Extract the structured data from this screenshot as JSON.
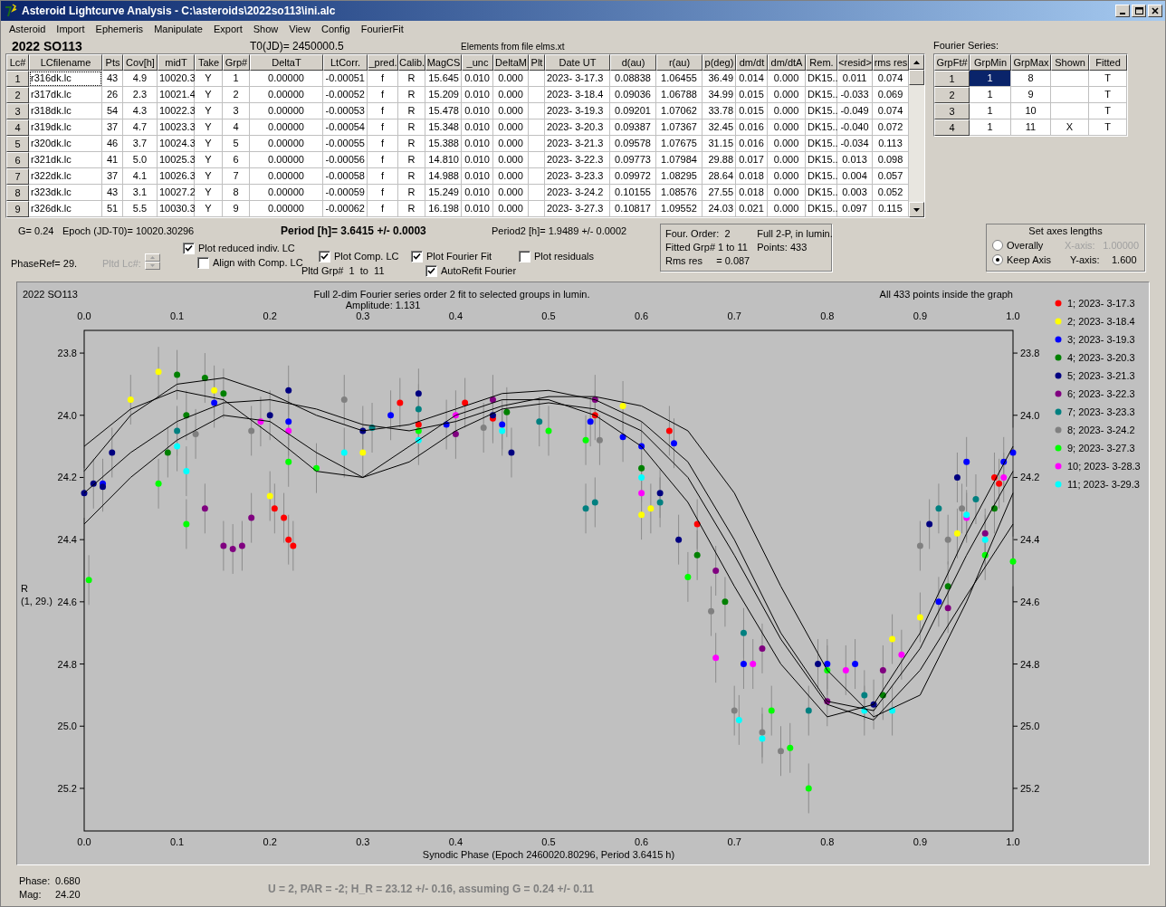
{
  "window": {
    "title": "Asteroid Lightcurve Analysis - C:\\asteroids\\2022so113\\ini.alc"
  },
  "menu": [
    "Asteroid",
    "Import",
    "Ephemeris",
    "Manipulate",
    "Export",
    "Show",
    "View",
    "Config",
    "FourierFit"
  ],
  "object_name": "2022 SO113",
  "t0": "T0(JD)= 2450000.5",
  "elements_note": "Elements from file elms.xt",
  "lc_table": {
    "columns": [
      "Lc#",
      "LCfilename",
      "Pts",
      "Cov[h]",
      "midT",
      "Take",
      "Grp#",
      "DeltaT",
      "LtCorr.",
      "_pred.",
      "Calib.",
      "MagCS",
      "_unc",
      "DeltaM",
      "Plt",
      "Date UT",
      "d(au)",
      "r(au)",
      "p(deg)",
      "dm/dt",
      "dm/dtA",
      "Rem.",
      "<resid>",
      "rms res"
    ],
    "rows": [
      {
        "focused": true,
        "cells": [
          "1",
          "r316dk.lc",
          "43",
          "4.9",
          "10020.3",
          "Y",
          "1",
          "0.00000",
          "-0.00051",
          "f",
          "R",
          "15.645",
          "0.010",
          "0.000",
          "",
          "2023- 3-17.3",
          "0.08838",
          "1.06455",
          "36.49",
          "0.014",
          "0.000",
          "DK15..",
          "0.011",
          "0.074"
        ]
      },
      {
        "focused": false,
        "cells": [
          "2",
          "r317dk.lc",
          "26",
          "2.3",
          "10021.4",
          "Y",
          "2",
          "0.00000",
          "-0.00052",
          "f",
          "R",
          "15.209",
          "0.010",
          "0.000",
          "",
          "2023- 3-18.4",
          "0.09036",
          "1.06788",
          "34.99",
          "0.015",
          "0.000",
          "DK15..",
          "-0.033",
          "0.069"
        ]
      },
      {
        "focused": false,
        "cells": [
          "3",
          "r318dk.lc",
          "54",
          "4.3",
          "10022.3",
          "Y",
          "3",
          "0.00000",
          "-0.00053",
          "f",
          "R",
          "15.478",
          "0.010",
          "0.000",
          "",
          "2023- 3-19.3",
          "0.09201",
          "1.07062",
          "33.78",
          "0.015",
          "0.000",
          "DK15..",
          "-0.049",
          "0.074"
        ]
      },
      {
        "focused": false,
        "cells": [
          "4",
          "r319dk.lc",
          "37",
          "4.7",
          "10023.3",
          "Y",
          "4",
          "0.00000",
          "-0.00054",
          "f",
          "R",
          "15.348",
          "0.010",
          "0.000",
          "",
          "2023- 3-20.3",
          "0.09387",
          "1.07367",
          "32.45",
          "0.016",
          "0.000",
          "DK15..",
          "-0.040",
          "0.072"
        ]
      },
      {
        "focused": false,
        "cells": [
          "5",
          "r320dk.lc",
          "46",
          "3.7",
          "10024.3",
          "Y",
          "5",
          "0.00000",
          "-0.00055",
          "f",
          "R",
          "15.388",
          "0.010",
          "0.000",
          "",
          "2023- 3-21.3",
          "0.09578",
          "1.07675",
          "31.15",
          "0.016",
          "0.000",
          "DK15..",
          "-0.034",
          "0.113"
        ]
      },
      {
        "focused": false,
        "cells": [
          "6",
          "r321dk.lc",
          "41",
          "5.0",
          "10025.3",
          "Y",
          "6",
          "0.00000",
          "-0.00056",
          "f",
          "R",
          "14.810",
          "0.010",
          "0.000",
          "",
          "2023- 3-22.3",
          "0.09773",
          "1.07984",
          "29.88",
          "0.017",
          "0.000",
          "DK15..",
          "0.013",
          "0.098"
        ]
      },
      {
        "focused": false,
        "cells": [
          "7",
          "r322dk.lc",
          "37",
          "4.1",
          "10026.3",
          "Y",
          "7",
          "0.00000",
          "-0.00058",
          "f",
          "R",
          "14.988",
          "0.010",
          "0.000",
          "",
          "2023- 3-23.3",
          "0.09972",
          "1.08295",
          "28.64",
          "0.018",
          "0.000",
          "DK15..",
          "0.004",
          "0.057"
        ]
      },
      {
        "focused": false,
        "cells": [
          "8",
          "r323dk.lc",
          "43",
          "3.1",
          "10027.2",
          "Y",
          "8",
          "0.00000",
          "-0.00059",
          "f",
          "R",
          "15.249",
          "0.010",
          "0.000",
          "",
          "2023- 3-24.2",
          "0.10155",
          "1.08576",
          "27.55",
          "0.018",
          "0.000",
          "DK15..",
          "0.003",
          "0.052"
        ]
      },
      {
        "focused": false,
        "cells": [
          "9",
          "r326dk.lc",
          "51",
          "5.5",
          "10030.3",
          "Y",
          "9",
          "0.00000",
          "-0.00062",
          "f",
          "R",
          "16.198",
          "0.010",
          "0.000",
          "",
          "2023- 3-27.3",
          "0.10817",
          "1.09552",
          "24.03",
          "0.021",
          "0.000",
          "DK15..",
          "0.097",
          "0.115"
        ]
      }
    ]
  },
  "fourier": {
    "label": "Fourier Series:",
    "columns": [
      "GrpFt#",
      "GrpMin",
      "GrpMax",
      "Shown",
      "Fitted"
    ],
    "rows": [
      {
        "selected": true,
        "cells": [
          "1",
          "1",
          "8",
          "",
          "T"
        ]
      },
      {
        "selected": false,
        "cells": [
          "2",
          "1",
          "9",
          "",
          "T"
        ]
      },
      {
        "selected": false,
        "cells": [
          "3",
          "1",
          "10",
          "",
          "T"
        ]
      },
      {
        "selected": false,
        "cells": [
          "4",
          "1",
          "11",
          "X",
          "T"
        ]
      }
    ]
  },
  "info": {
    "g": "G= 0.24",
    "epoch": "Epoch (JD-T0)= 10020.30296",
    "period": "Period [h]= 3.6415 +/- 0.0003",
    "period2": "Period2 [h]= 1.9489 +/- 0.0002",
    "phase_ref": "PhaseRef= 29.",
    "pltd_lc": {
      "label": "Pltd Lc#:",
      "disabled": true
    },
    "pltd_grp": "Pltd Grp#  1  to  11"
  },
  "checkboxes": [
    {
      "label": "Plot reduced indiv. LC",
      "checked": true
    },
    {
      "label": "Align with Comp. LC",
      "checked": false
    },
    {
      "label": "Plot Comp. LC",
      "checked": true
    },
    {
      "label": "Plot Fourier Fit",
      "checked": true
    },
    {
      "label": "AutoRefit Fourier",
      "checked": true
    },
    {
      "label": "Plot residuals",
      "checked": false
    }
  ],
  "fit_info": {
    "left": [
      "Four. Order:  2",
      "Fitted Grp# 1 to 11",
      "Rms res     = 0.087"
    ],
    "right": [
      "Full 2-P, in lumin.",
      "Points: 433"
    ]
  },
  "axes": {
    "title": "Set axes lengths",
    "options": [
      {
        "label": "Overally",
        "selected": false
      },
      {
        "label": "Keep Axis",
        "selected": true
      }
    ],
    "x_axis": {
      "label": "X-axis:",
      "value": "1.00000",
      "disabled": true
    },
    "y_axis": {
      "label": "Y-axis:",
      "value": "1.600",
      "disabled": false
    }
  },
  "plot": {
    "left_title": "2022 SO113",
    "title": "Full 2-dim Fourier series order 2 fit to selected groups in lumin.",
    "amplitude": "Amplitude: 1.131",
    "right_title": "All 433 points inside the graph",
    "ylabel": [
      "R",
      "(1, 29.)"
    ],
    "chart_data": {
      "type": "scatter",
      "xlabel": "Synodic Phase (Epoch 2460020.80296, Period 3.6415 h)",
      "xlim": [
        0,
        1
      ],
      "ylim": [
        25.337,
        23.727
      ],
      "xticks": [
        {
          "value": 0,
          "label": "0.0"
        },
        {
          "value": 0.1,
          "label": "0.1"
        },
        {
          "value": 0.2,
          "label": "0.2"
        },
        {
          "value": 0.3,
          "label": "0.3"
        },
        {
          "value": 0.4,
          "label": "0.4"
        },
        {
          "value": 0.5,
          "label": "0.5"
        },
        {
          "value": 0.6,
          "label": "0.6"
        },
        {
          "value": 0.7,
          "label": "0.7"
        },
        {
          "value": 0.8,
          "label": "0.8"
        },
        {
          "value": 0.9,
          "label": "0.9"
        },
        {
          "value": 1,
          "label": "1.0"
        }
      ],
      "yticks": [
        {
          "value": 23.8,
          "label": "23.8"
        },
        {
          "value": 24,
          "label": "24.0"
        },
        {
          "value": 24.2,
          "label": "24.2"
        },
        {
          "value": 24.4,
          "label": "24.4"
        },
        {
          "value": 24.6,
          "label": "24.6"
        },
        {
          "value": 24.8,
          "label": "24.8"
        },
        {
          "value": 25,
          "label": "25.0"
        },
        {
          "value": 25.2,
          "label": "25.2"
        }
      ],
      "series": [
        {
          "type": "scatter",
          "name": "1; 2023- 3-17.3",
          "errors": [
            0.08,
            0.08,
            0.08,
            0.08,
            0.08,
            0.08,
            0.08,
            0.08,
            0.08,
            0.08,
            0.08,
            0.08,
            0.08
          ],
          "color": "#ff0000",
          "x": [
            0.205,
            0.215,
            0.225,
            0.22,
            0.34,
            0.36,
            0.41,
            0.44,
            0.55,
            0.63,
            0.66,
            0.98,
            0.985
          ],
          "values": [
            24.3,
            24.33,
            24.42,
            24.4,
            23.96,
            24.03,
            23.96,
            24.01,
            24.0,
            24.05,
            24.35,
            24.2,
            24.22
          ]
        },
        {
          "type": "scatter",
          "name": "2; 2023- 3-18.4",
          "errors": [
            0.08,
            0.08,
            0.08,
            0.08,
            0.08,
            0.08,
            0.08,
            0.08,
            0.08,
            0.08,
            0.08
          ],
          "color": "#ffff00",
          "x": [
            0.05,
            0.08,
            0.14,
            0.2,
            0.3,
            0.58,
            0.6,
            0.61,
            0.87,
            0.9,
            0.94
          ],
          "values": [
            23.95,
            23.86,
            23.92,
            24.26,
            24.12,
            23.97,
            24.32,
            24.3,
            24.72,
            24.65,
            24.38
          ]
        },
        {
          "type": "scatter",
          "name": "3; 2023- 3-19.3",
          "errors": [
            0.08,
            0.08,
            0.08,
            0.08,
            0.08,
            0.08,
            0.08,
            0.08,
            0.08,
            0.08,
            0.08,
            0.08,
            0.08,
            0.08,
            0.08,
            0.08,
            0.08
          ],
          "color": "#0000ff",
          "x": [
            0.02,
            0.14,
            0.22,
            0.33,
            0.39,
            0.45,
            0.545,
            0.58,
            0.6,
            0.635,
            0.71,
            0.8,
            0.83,
            0.92,
            0.95,
            0.99,
            1.0
          ],
          "values": [
            24.22,
            23.96,
            24.02,
            24.0,
            24.03,
            24.03,
            24.02,
            24.07,
            24.1,
            24.09,
            24.8,
            24.8,
            24.8,
            24.6,
            24.15,
            24.15,
            24.12
          ]
        },
        {
          "type": "scatter",
          "name": "4; 2023- 3-20.3",
          "errors": [
            0.08,
            0.08,
            0.08,
            0.08,
            0.08,
            0.08,
            0.08,
            0.08,
            0.08,
            0.08,
            0.08,
            0.08
          ],
          "color": "#008000",
          "x": [
            0.09,
            0.1,
            0.11,
            0.13,
            0.15,
            0.455,
            0.6,
            0.66,
            0.69,
            0.86,
            0.93,
            0.98
          ],
          "values": [
            24.12,
            23.87,
            24.0,
            23.88,
            23.93,
            23.99,
            24.17,
            24.45,
            24.6,
            24.9,
            24.55,
            24.3
          ]
        },
        {
          "type": "scatter",
          "name": "5; 2023- 3-21.3",
          "errors": [
            0.08,
            0.08,
            0.08,
            0.08,
            0.08,
            0.08,
            0.08,
            0.08,
            0.08,
            0.08,
            0.08,
            0.08,
            0.08,
            0.08,
            0.08,
            0.08
          ],
          "color": "#000080",
          "x": [
            0.0,
            0.01,
            0.02,
            0.03,
            0.2,
            0.22,
            0.3,
            0.36,
            0.44,
            0.46,
            0.62,
            0.64,
            0.79,
            0.85,
            0.91,
            0.94
          ],
          "values": [
            24.25,
            24.22,
            24.23,
            24.12,
            24.0,
            23.92,
            24.05,
            23.93,
            24.0,
            24.12,
            24.25,
            24.4,
            24.8,
            24.93,
            24.35,
            24.2
          ]
        },
        {
          "type": "scatter",
          "name": "6; 2023- 3-22.3",
          "errors": [
            0.08,
            0.08,
            0.08,
            0.08,
            0.08,
            0.08,
            0.08,
            0.08,
            0.08,
            0.08,
            0.08,
            0.08,
            0.08,
            0.08
          ],
          "color": "#800080",
          "x": [
            0.13,
            0.15,
            0.16,
            0.17,
            0.18,
            0.4,
            0.44,
            0.55,
            0.68,
            0.73,
            0.8,
            0.86,
            0.93,
            0.97
          ],
          "values": [
            24.3,
            24.42,
            24.43,
            24.42,
            24.33,
            24.06,
            23.95,
            23.95,
            24.5,
            24.75,
            24.92,
            24.82,
            24.62,
            24.38
          ]
        },
        {
          "type": "scatter",
          "name": "7; 2023- 3-23.3",
          "errors": [
            0.08,
            0.08,
            0.08,
            0.08,
            0.08,
            0.08,
            0.08,
            0.08,
            0.08,
            0.08,
            0.08,
            0.08
          ],
          "color": "#008080",
          "x": [
            0.1,
            0.31,
            0.36,
            0.49,
            0.54,
            0.55,
            0.62,
            0.71,
            0.78,
            0.84,
            0.92,
            0.96
          ],
          "values": [
            24.05,
            24.04,
            23.98,
            24.02,
            24.3,
            24.28,
            24.28,
            24.7,
            24.95,
            24.9,
            24.3,
            24.27
          ]
        },
        {
          "type": "scatter",
          "name": "8; 2023- 3-24.2",
          "errors": [
            0.08,
            0.08,
            0.08,
            0.08,
            0.08,
            0.08,
            0.08,
            0.08,
            0.08,
            0.08,
            0.08,
            0.08
          ],
          "color": "#808080",
          "x": [
            0.12,
            0.18,
            0.28,
            0.43,
            0.555,
            0.675,
            0.7,
            0.73,
            0.75,
            0.9,
            0.93,
            0.945
          ],
          "values": [
            24.06,
            24.05,
            23.95,
            24.04,
            24.08,
            24.63,
            24.95,
            25.02,
            25.08,
            24.42,
            24.4,
            24.3
          ]
        },
        {
          "type": "scatter",
          "name": "9; 2023- 3-27.3",
          "errors": [
            0.08,
            0.08,
            0.08,
            0.08,
            0.08,
            0.08,
            0.08,
            0.08,
            0.08,
            0.08,
            0.08,
            0.08,
            0.08,
            0.08,
            0.08
          ],
          "color": "#00ff00",
          "x": [
            0.005,
            0.08,
            0.11,
            0.22,
            0.25,
            0.36,
            0.5,
            0.54,
            0.65,
            0.74,
            0.76,
            0.78,
            0.8,
            0.97,
            1.0
          ],
          "values": [
            24.53,
            24.22,
            24.35,
            24.15,
            24.17,
            24.05,
            24.05,
            24.08,
            24.52,
            24.95,
            25.07,
            25.2,
            24.82,
            24.45,
            24.47
          ]
        },
        {
          "type": "scatter",
          "name": "10; 2023- 3-28.3",
          "errors": [
            0.08,
            0.08,
            0.08,
            0.08,
            0.08,
            0.08,
            0.08,
            0.08,
            0.08,
            0.08
          ],
          "color": "#ff00ff",
          "x": [
            0.19,
            0.22,
            0.4,
            0.6,
            0.68,
            0.72,
            0.82,
            0.88,
            0.95,
            0.99
          ],
          "values": [
            24.02,
            24.05,
            24.0,
            24.25,
            24.78,
            24.8,
            24.82,
            24.77,
            24.33,
            24.2
          ]
        },
        {
          "type": "scatter",
          "name": "11; 2023- 3-29.3",
          "errors": [
            0.08,
            0.08,
            0.08,
            0.08,
            0.08,
            0.08,
            0.08,
            0.08,
            0.08,
            0.08,
            0.08,
            0.08
          ],
          "color": "#00ffff",
          "x": [
            0.1,
            0.11,
            0.28,
            0.36,
            0.45,
            0.6,
            0.705,
            0.73,
            0.84,
            0.87,
            0.95,
            0.97
          ],
          "values": [
            24.1,
            24.18,
            24.12,
            24.08,
            24.05,
            24.2,
            24.98,
            25.04,
            24.95,
            24.95,
            24.32,
            24.4
          ]
        },
        {
          "type": "line",
          "color": "#000000",
          "x": [
            0,
            0.05,
            0.1,
            0.15,
            0.2,
            0.25,
            0.3,
            0.35,
            0.4,
            0.45,
            0.5,
            0.55,
            0.6,
            0.65,
            0.7,
            0.75,
            0.8,
            0.85,
            0.9,
            0.95,
            1
          ],
          "values": [
            24.25,
            24.12,
            24.02,
            23.96,
            23.95,
            23.98,
            24.03,
            24.05,
            24.02,
            23.97,
            23.94,
            23.94,
            23.97,
            24.05,
            24.25,
            24.55,
            24.82,
            24.97,
            24.9,
            24.6,
            24.25
          ]
        },
        {
          "type": "line",
          "color": "#000000",
          "x": [
            0,
            0.05,
            0.1,
            0.15,
            0.2,
            0.25,
            0.3,
            0.35,
            0.4,
            0.45,
            0.5,
            0.55,
            0.6,
            0.65,
            0.7,
            0.75,
            0.8,
            0.85,
            0.9,
            0.95,
            1
          ],
          "values": [
            24.18,
            24.0,
            23.9,
            23.88,
            23.93,
            24.0,
            24.05,
            24.03,
            23.98,
            23.93,
            23.92,
            23.95,
            24.02,
            24.15,
            24.4,
            24.7,
            24.92,
            24.95,
            24.75,
            24.45,
            24.18
          ]
        },
        {
          "type": "line",
          "color": "#000000",
          "x": [
            0,
            0.05,
            0.1,
            0.15,
            0.2,
            0.25,
            0.3,
            0.35,
            0.4,
            0.45,
            0.5,
            0.55,
            0.6,
            0.65,
            0.7,
            0.75,
            0.8,
            0.85,
            0.9,
            0.95,
            1
          ],
          "values": [
            24.35,
            24.2,
            24.08,
            24.0,
            24.02,
            24.12,
            24.2,
            24.15,
            24.05,
            23.98,
            23.96,
            23.98,
            24.05,
            24.2,
            24.45,
            24.72,
            24.93,
            24.98,
            24.82,
            24.58,
            24.35
          ]
        },
        {
          "type": "line",
          "color": "#000000",
          "x": [
            0,
            0.05,
            0.1,
            0.15,
            0.2,
            0.25,
            0.3,
            0.35,
            0.4,
            0.45,
            0.5,
            0.55,
            0.6,
            0.65,
            0.7,
            0.75,
            0.8,
            0.85,
            0.9,
            0.95,
            1
          ],
          "values": [
            24.1,
            23.98,
            23.92,
            23.95,
            24.06,
            24.18,
            24.2,
            24.1,
            24.0,
            23.95,
            23.95,
            24.0,
            24.1,
            24.28,
            24.55,
            24.8,
            24.97,
            24.93,
            24.7,
            24.38,
            24.1
          ]
        }
      ],
      "legend": true
    }
  },
  "status": {
    "phase": {
      "label": "Phase:",
      "value": "0.680"
    },
    "mag": {
      "label": "Mag:",
      "value": "24.20"
    },
    "result": "U = 2, PAR = -2; H_R = 23.12 +/- 0.16, assuming G = 0.24 +/- 0.11"
  }
}
